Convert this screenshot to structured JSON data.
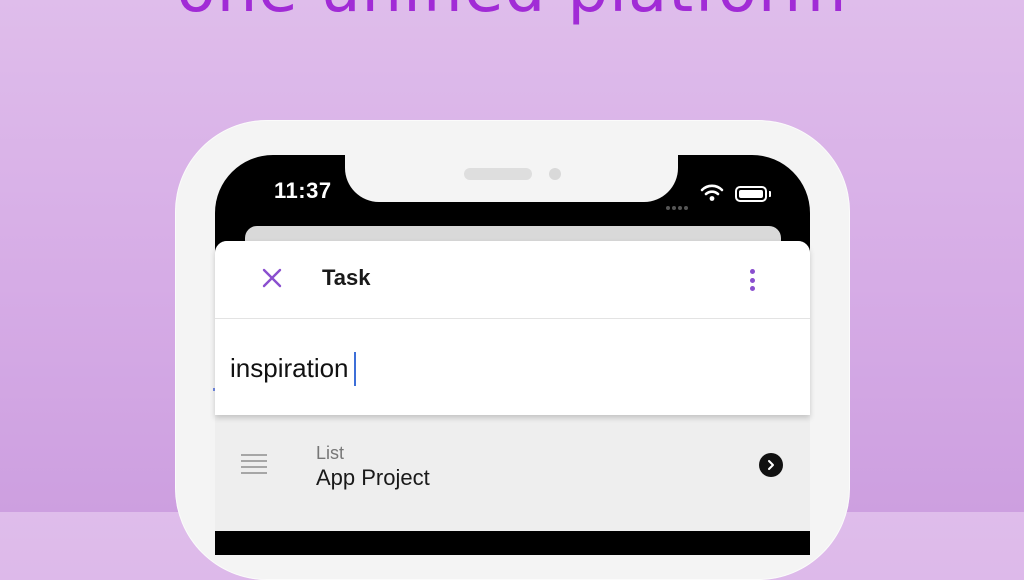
{
  "headline": "one unified platform",
  "status_bar": {
    "time": "11:37"
  },
  "header": {
    "title": "Task",
    "close_icon": "close-icon",
    "more_icon": "more-vertical-icon"
  },
  "task": {
    "value": "inspiration"
  },
  "list_row": {
    "caption": "List",
    "value": "App Project",
    "icon": "list-lines-icon",
    "chevron": "chevron-right-icon"
  },
  "colors": {
    "accent": "#8a4fcf",
    "headline": "#a12bd6",
    "background": "#dfbdeb",
    "caret": "#3d6fd8"
  }
}
